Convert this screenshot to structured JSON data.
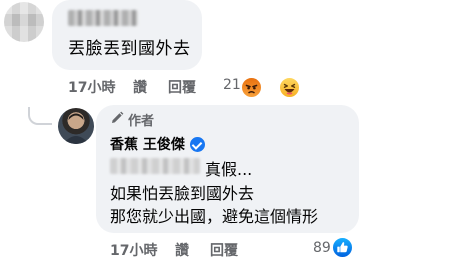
{
  "top_comment": {
    "text": "丟臉丟到國外去",
    "time": "17小時",
    "like_label": "讚",
    "reply_label": "回覆",
    "reaction_count": "21",
    "reactions": [
      "angry-icon",
      "haha-icon"
    ]
  },
  "reply_comment": {
    "author_badge": "作者",
    "author_name": "香蕉 王俊傑",
    "line1": "真假...",
    "line2": "如果怕丟臉到國外去",
    "line3": "那您就少出國，避免這個情形",
    "time": "17小時",
    "like_label": "讚",
    "reply_label": "回覆",
    "reaction_count": "89",
    "reactions": [
      "like-icon"
    ]
  },
  "colors": {
    "bubble": "#f0f2f5",
    "meta_text": "#65676b",
    "verified": "#1877f2"
  }
}
